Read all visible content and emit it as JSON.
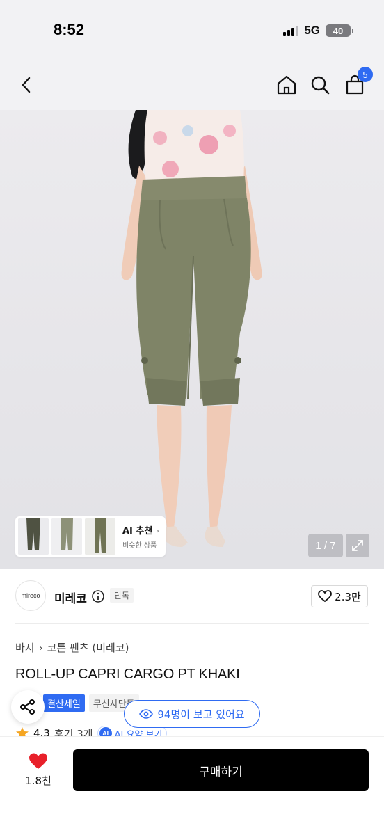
{
  "status": {
    "time": "8:52",
    "network": "5G",
    "battery": "40"
  },
  "nav": {
    "cart_count": "5"
  },
  "gallery": {
    "ai_rec_title": "AI 추천",
    "ai_rec_sub": "비슷한 상품",
    "counter": "1 / 7"
  },
  "brand": {
    "logo_text": "mireco",
    "name": "미레코",
    "exclusive": "단독",
    "likes": "2.3만"
  },
  "breadcrumb": {
    "category": "바지",
    "subcategory": "코튼 팬츠 (미레코)"
  },
  "product": {
    "title": "ROLL-UP CAPRI CARGO PT KHAKI"
  },
  "badges": {
    "sale": "결산세일",
    "delivery": "무신사단독"
  },
  "viewers": "94명이 보고 있어요",
  "rating": {
    "score": "4.3",
    "reviews": "후기 3개",
    "ai_badge": "AI",
    "ai_summary": "AI 요약 보기"
  },
  "bottom": {
    "wish_count": "1.8천",
    "buy_label": "구매하기"
  },
  "colors": {
    "accent": "#2f6bf2",
    "heart": "#e8202a",
    "pants": "#7f8467"
  },
  "icons": [
    "back-arrow-icon",
    "home-icon",
    "search-icon",
    "cart-icon",
    "info-icon",
    "heart-outline-icon",
    "share-icon",
    "eye-icon",
    "star-icon",
    "heart-filled-icon",
    "expand-icon",
    "chevron-right-icon"
  ]
}
